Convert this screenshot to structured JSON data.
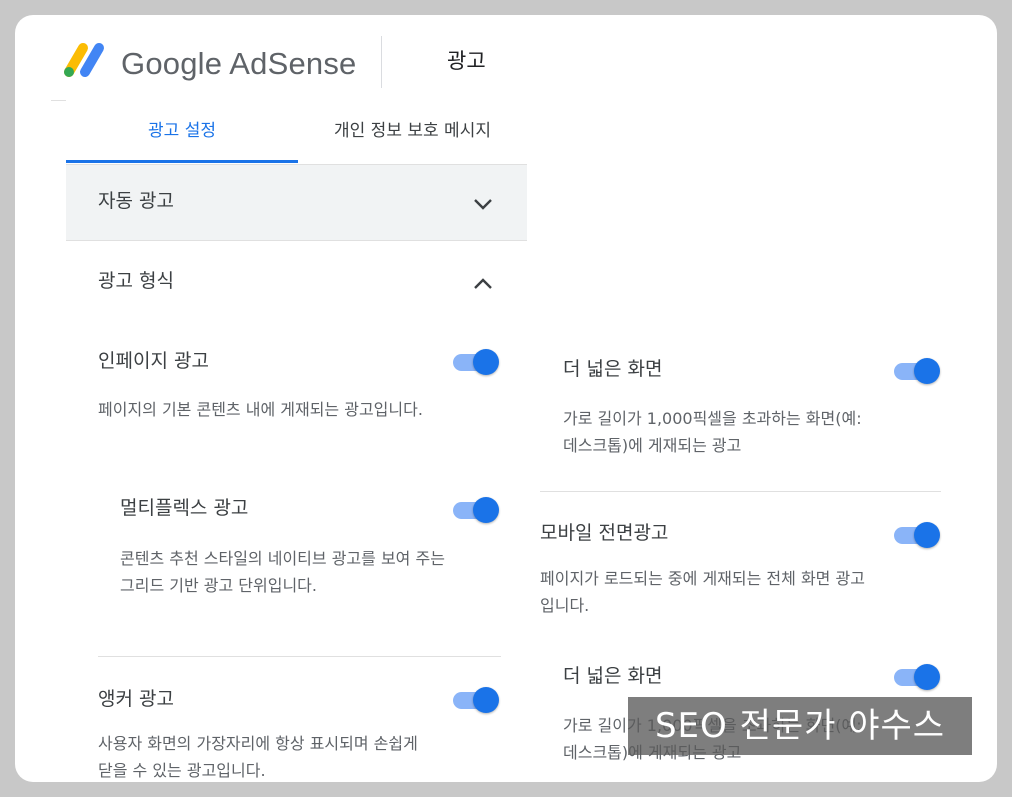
{
  "header": {
    "brand": "Google AdSense",
    "title": "광고",
    "logo_icon": "adsense-logo-icon",
    "logo_colors": [
      "#fbbc04",
      "#4285f4",
      "#34a853"
    ]
  },
  "tabs": [
    {
      "label": "광고 설정",
      "active": true
    },
    {
      "label": "개인 정보 보호 메시지",
      "active": false
    }
  ],
  "sections": {
    "auto_ads": {
      "title": "자동 광고",
      "icon": "chevron-down-icon"
    },
    "ad_formats": {
      "title": "광고 형식",
      "icon": "chevron-up-icon"
    }
  },
  "left_items": {
    "inpage": {
      "title": "인페이지 광고",
      "desc": "페이지의 기본 콘텐츠 내에 게재되는 광고입니다.",
      "enabled": true
    },
    "multiplex": {
      "title": "멀티플렉스 광고",
      "desc": "콘텐츠 추천 스타일의 네이티브 광고를 보여 주는 그리드 기반 광고 단위입니다.",
      "enabled": true
    },
    "anchor": {
      "title": "앵커 광고",
      "desc": "사용자 화면의 가장자리에 항상 표시되며 손쉽게 닫을 수 있는 광고입니다.",
      "enabled": true
    }
  },
  "right_items": {
    "wider_screen_1": {
      "title": "더 넓은 화면",
      "desc": "가로 길이가 1,000픽셀을 초과하는 화면(예: 데스크톱)에 게재되는 광고",
      "enabled": true
    },
    "vignette": {
      "title": "모바일 전면광고",
      "desc": "페이지가 로드되는 중에 게재되는 전체 화면 광고입니다.",
      "enabled": true
    },
    "wider_screen_2": {
      "title": "더 넓은 화면",
      "desc": "가로 길이가 1,000픽셀을 초과하는 화면(예: 데스크톱)에 게재되는 광고",
      "enabled": true
    }
  },
  "watermark": "SEO 전문가 야수스",
  "colors": {
    "accent": "#1a73e8",
    "toggle_track": "#8ab4f8",
    "section_bg": "#f1f3f4",
    "page_bg": "#c8c8c8"
  }
}
